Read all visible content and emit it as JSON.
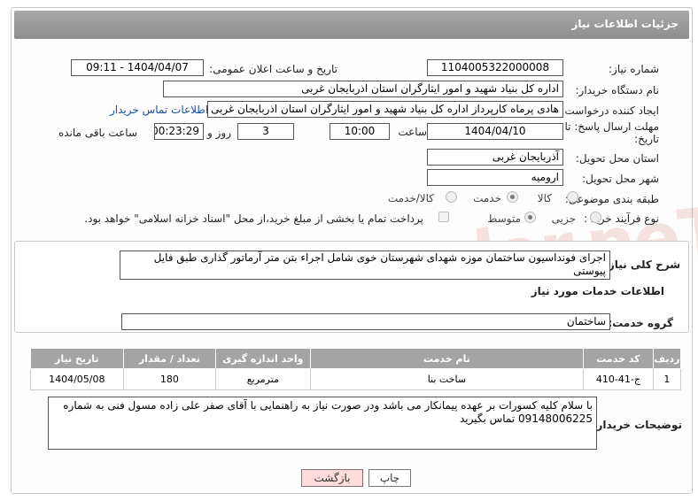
{
  "header": {
    "title": "جزئیات اطلاعات نیاز"
  },
  "need": {
    "number_label": "شماره نیاز:",
    "number_value": "1104005322000008",
    "announce_label": "تاریخ و ساعت اعلان عمومی:",
    "announce_value": "1404/04/07 - 09:11",
    "buyer_label": "نام دستگاه خریدار:",
    "buyer_value": "اداره کل بنیاد شهید و امور ایثارگران استان اذربایجان غربی",
    "creator_label": "ایجاد کننده درخواست:",
    "creator_value": "هادی پرماه کارپرداز اداره کل بنیاد شهید و امور ایثارگران استان اذربایجان غربی",
    "contact_link": "اطلاعات تماس خریدار",
    "deadline_label_1": "مهلت ارسال پاسخ: تا",
    "deadline_label_2": "تاریخ:",
    "deadline_date": "1404/04/10",
    "time_label": "ساعت",
    "deadline_time": "10:00",
    "days_value": "3",
    "days_label": "روز و",
    "remaining_value": "00:23:29",
    "remaining_label": "ساعت باقی مانده",
    "province_label": "استان محل تحویل:",
    "province_value": "آذربایجان غربی",
    "city_label": "شهر محل تحویل:",
    "city_value": "ارومیه",
    "category_label": "طبقه بندی موضوعی:",
    "category_options": [
      "کالا",
      "خدمت",
      "کالا/خدمت"
    ],
    "category_selected": "خدمت",
    "process_label": "نوع فرآیند خرید :",
    "process_options": [
      "جزیی",
      "متوسط"
    ],
    "process_selected": "متوسط",
    "payment_note": "پرداخت تمام یا بخشی از مبلغ خرید،از محل \"اسناد خزانه اسلامی\" خواهد بود."
  },
  "summary": {
    "label": "شرح کلی نیاز:",
    "value": "اجرای فونداسیون ساختمان موزه شهدای شهرستان خوی شامل اجراء بتن متر آرماتور گذاری طبق فایل پیوستی"
  },
  "services": {
    "section_title": "اطلاعات خدمات مورد نیاز",
    "group_label": "گروه خدمت:",
    "group_value": "ساختمان",
    "columns": [
      "ردیف",
      "کد خدمت",
      "نام خدمت",
      "واحد اندازه گیری",
      "تعداد / مقدار",
      "تاریخ نیاز"
    ],
    "rows": [
      [
        "1",
        "ج-41-410",
        "ساخت بنا",
        "مترمربع",
        "180",
        "1404/05/08"
      ]
    ]
  },
  "buyer_notes": {
    "label": "توضیحات خریدار:",
    "value": "با سلام کلیه کسورات بر عهده پیمانکار می باشد ودر صورت نیاز به راهنمایی با آقای صفر علی زاده مسول فنی به شماره 09148006225 تماس بگیرید"
  },
  "actions": {
    "print": "چاپ",
    "back": "بازگشت"
  },
  "colors": {
    "header_bg": "#9a9a9a",
    "link": "#1a4fa0",
    "back_button": "#ffdcdc",
    "watermark": "#c82828"
  },
  "watermark": "AriaTender.neT"
}
